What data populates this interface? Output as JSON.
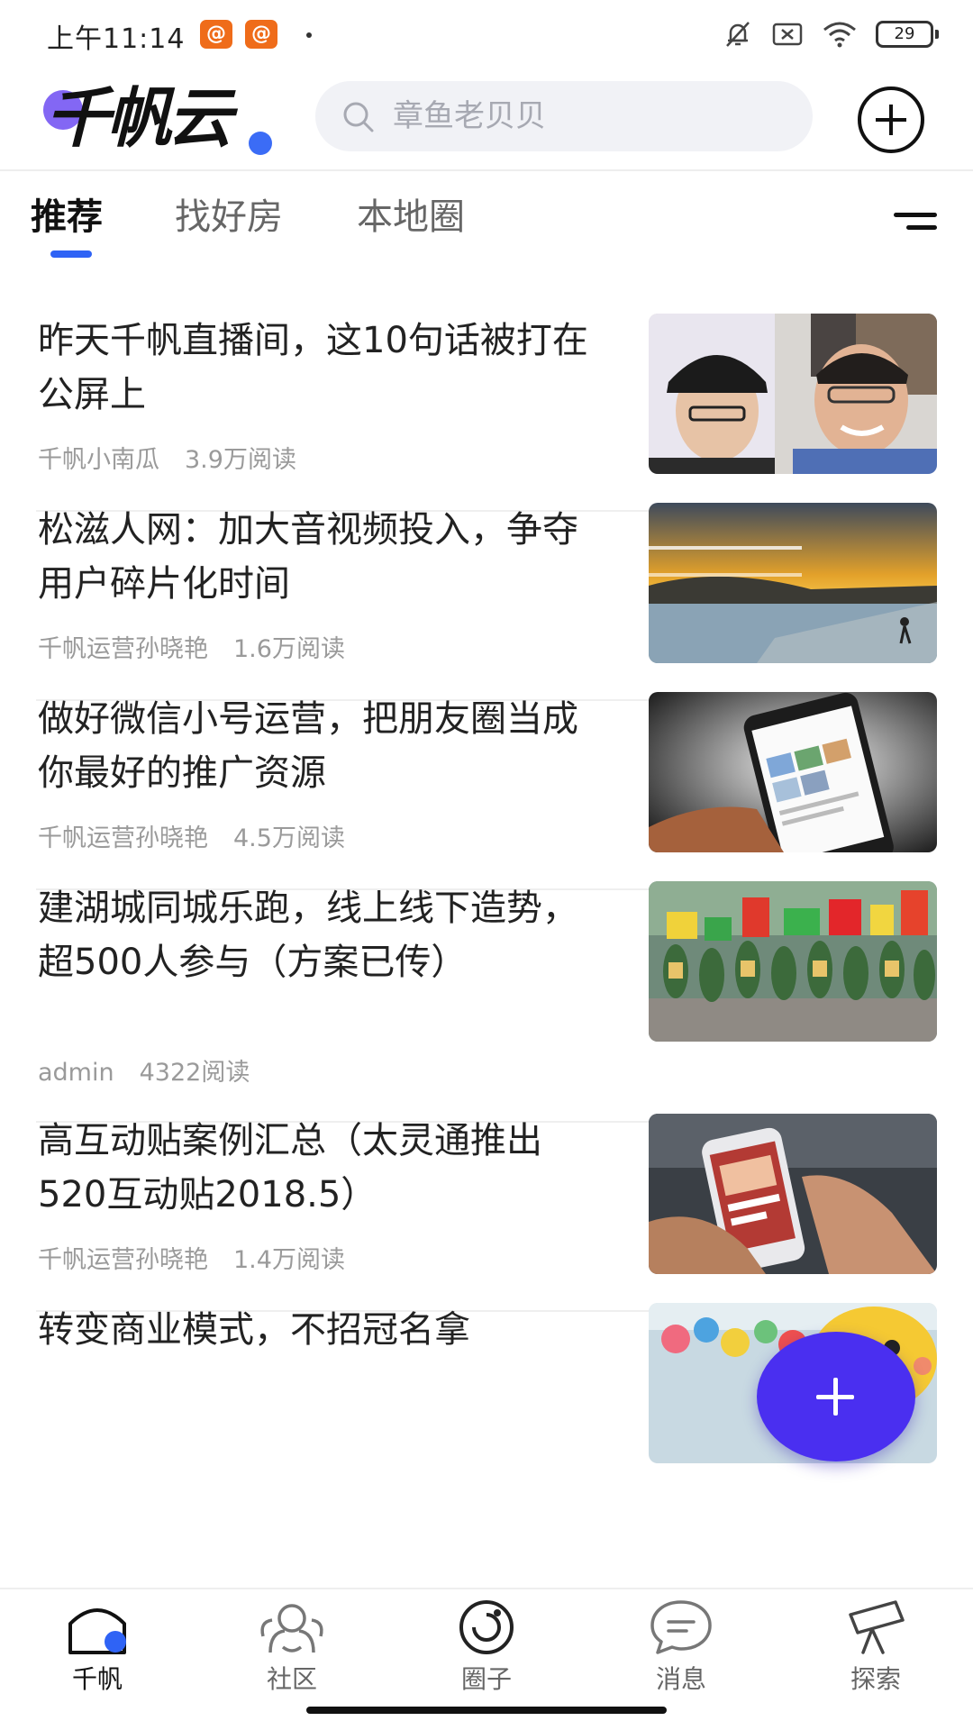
{
  "status_bar": {
    "time": "上午11:14",
    "notifications": [
      "weibo-icon",
      "weibo-icon"
    ],
    "battery": "29"
  },
  "header": {
    "logo_text": "千帆云",
    "search_placeholder": "章鱼老贝贝"
  },
  "tabs": [
    {
      "label": "推荐",
      "active": true
    },
    {
      "label": "找好房",
      "active": false
    },
    {
      "label": "本地圈",
      "active": false
    }
  ],
  "articles": [
    {
      "title": "昨天千帆直播间，这10句话被打在公屏上",
      "author": "千帆小南瓜",
      "reads": "3.9万阅读",
      "thumb": "livestream-hosts-photo"
    },
    {
      "title": "松滋人网：加大音视频投入，争夺用户碎片化时间",
      "author": "千帆运营孙晓艳",
      "reads": "1.6万阅读",
      "thumb": "sunset-beach-photo"
    },
    {
      "title": "做好微信小号运营，把朋友圈当成你最好的推广资源",
      "author": "千帆运营孙晓艳",
      "reads": "4.5万阅读",
      "thumb": "phone-wechat-photo"
    },
    {
      "title": "建湖城同城乐跑，线上线下造势，超500人参与（方案已传）",
      "author": "admin",
      "reads": "4322阅读",
      "thumb": "running-crowd-photo"
    },
    {
      "title": "高互动贴案例汇总（太灵通推出520互动贴2018.5）",
      "author": "千帆运营孙晓艳",
      "reads": "1.4万阅读",
      "thumb": "hand-phone-photo"
    },
    {
      "title": "转变商业模式，不招冠名拿",
      "author": "",
      "reads": "",
      "thumb": "balloons-photo"
    }
  ],
  "bottom_nav": [
    {
      "label": "千帆",
      "icon": "home-icon",
      "active": true
    },
    {
      "label": "社区",
      "icon": "community-icon",
      "active": false
    },
    {
      "label": "圈子",
      "icon": "circle-icon",
      "active": false
    },
    {
      "label": "消息",
      "icon": "message-icon",
      "active": false
    },
    {
      "label": "探索",
      "icon": "explore-icon",
      "active": false
    }
  ],
  "colors": {
    "accent": "#2f63f5",
    "fab": "#4a2ff0",
    "weibo_badge": "#ef6c1a"
  }
}
